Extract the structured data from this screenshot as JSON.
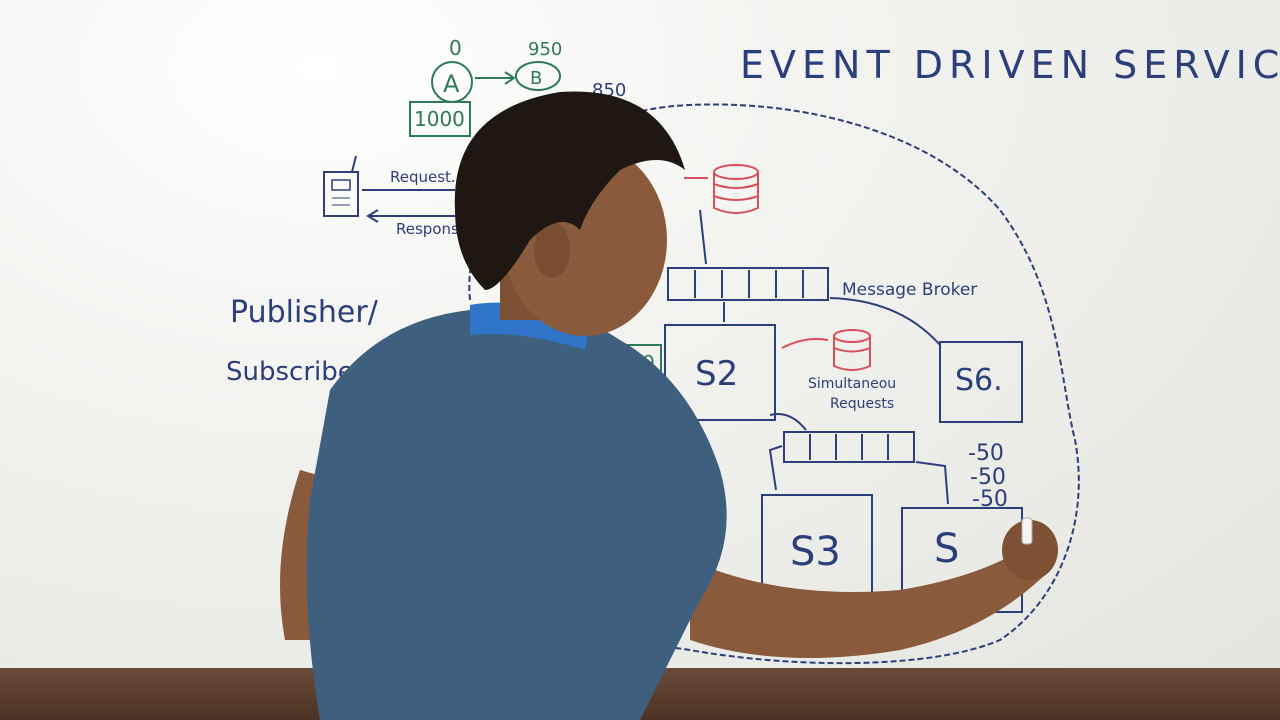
{
  "board": {
    "title": "EVENT DRIVEN SERVICES",
    "publisher_label": "Publisher/",
    "subscriber_label": "Subscriber.",
    "request_label": "Request.",
    "response_label": "Respons",
    "message_broker_label": "Message Broker",
    "simultaneous_label": "Simultaneou",
    "requests_label": "Requests",
    "service_a": "A",
    "service_b": "B",
    "top_value_zero": "0",
    "top_value_950": "950",
    "top_value_850": "850",
    "balance_1000": "1000",
    "balance_1800": "1800",
    "s2_label": "S2",
    "s3_label": "S3",
    "s4_label": "S",
    "s6_label": "S6.",
    "deduction_1": "-50",
    "deduction_2": "-50",
    "deduction_3": "-50"
  },
  "colors": {
    "whiteboard": "#efefec",
    "marker_blue": "#2c3f7a",
    "marker_green": "#2f7a5a",
    "marker_red": "#d9505a",
    "shirt": "#3f5f7e",
    "skin": "#8a5a3c",
    "hair": "#1f1712"
  },
  "icons": [
    "phone-icon",
    "database-icon"
  ]
}
